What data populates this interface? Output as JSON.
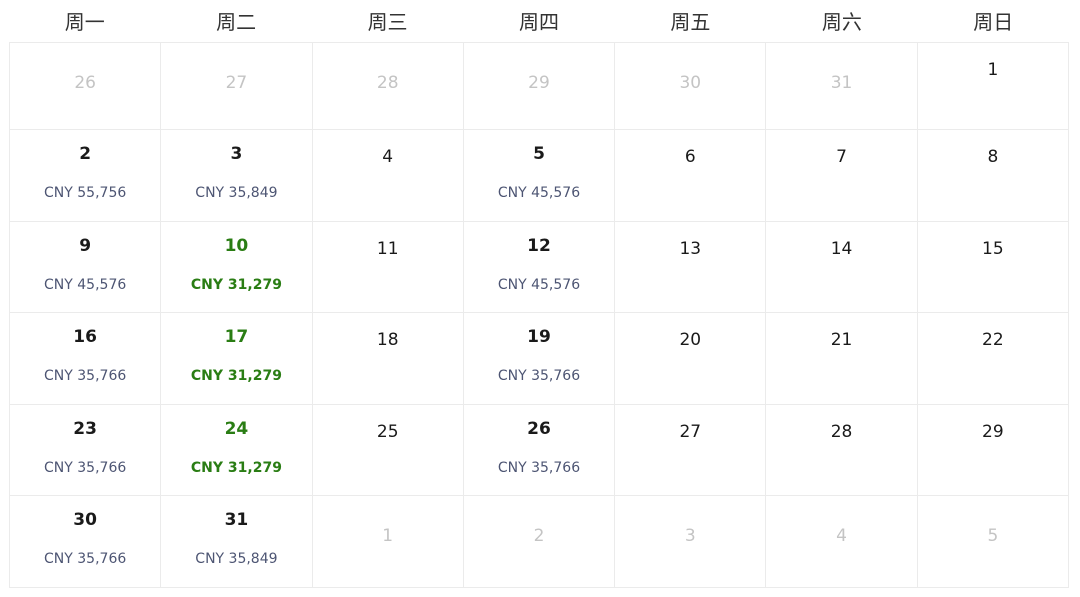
{
  "weekdays": [
    "周一",
    "周二",
    "周三",
    "周四",
    "周五",
    "周六",
    "周日"
  ],
  "colors": {
    "lowest_price": "#2a7d14",
    "price_text": "#4d5573",
    "muted_day": "#c4c4c4",
    "grid_line": "#ebebeb"
  },
  "weeks": [
    [
      {
        "day": "26",
        "muted": true
      },
      {
        "day": "27",
        "muted": true
      },
      {
        "day": "28",
        "muted": true
      },
      {
        "day": "29",
        "muted": true
      },
      {
        "day": "30",
        "muted": true
      },
      {
        "day": "31",
        "muted": true
      },
      {
        "day": "1"
      }
    ],
    [
      {
        "day": "2",
        "price": "CNY 55,756"
      },
      {
        "day": "3",
        "price": "CNY 35,849"
      },
      {
        "day": "4"
      },
      {
        "day": "5",
        "price": "CNY 45,576"
      },
      {
        "day": "6"
      },
      {
        "day": "7"
      },
      {
        "day": "8"
      }
    ],
    [
      {
        "day": "9",
        "price": "CNY 45,576"
      },
      {
        "day": "10",
        "price": "CNY 31,279",
        "lowest": true
      },
      {
        "day": "11"
      },
      {
        "day": "12",
        "price": "CNY 45,576"
      },
      {
        "day": "13"
      },
      {
        "day": "14"
      },
      {
        "day": "15"
      }
    ],
    [
      {
        "day": "16",
        "price": "CNY 35,766"
      },
      {
        "day": "17",
        "price": "CNY 31,279",
        "lowest": true
      },
      {
        "day": "18"
      },
      {
        "day": "19",
        "price": "CNY 35,766"
      },
      {
        "day": "20"
      },
      {
        "day": "21"
      },
      {
        "day": "22"
      }
    ],
    [
      {
        "day": "23",
        "price": "CNY 35,766"
      },
      {
        "day": "24",
        "price": "CNY 31,279",
        "lowest": true
      },
      {
        "day": "25"
      },
      {
        "day": "26",
        "price": "CNY 35,766"
      },
      {
        "day": "27"
      },
      {
        "day": "28"
      },
      {
        "day": "29"
      }
    ],
    [
      {
        "day": "30",
        "price": "CNY 35,766"
      },
      {
        "day": "31",
        "price": "CNY 35,849"
      },
      {
        "day": "1",
        "muted": true
      },
      {
        "day": "2",
        "muted": true
      },
      {
        "day": "3",
        "muted": true
      },
      {
        "day": "4",
        "muted": true
      },
      {
        "day": "5",
        "muted": true
      }
    ]
  ]
}
